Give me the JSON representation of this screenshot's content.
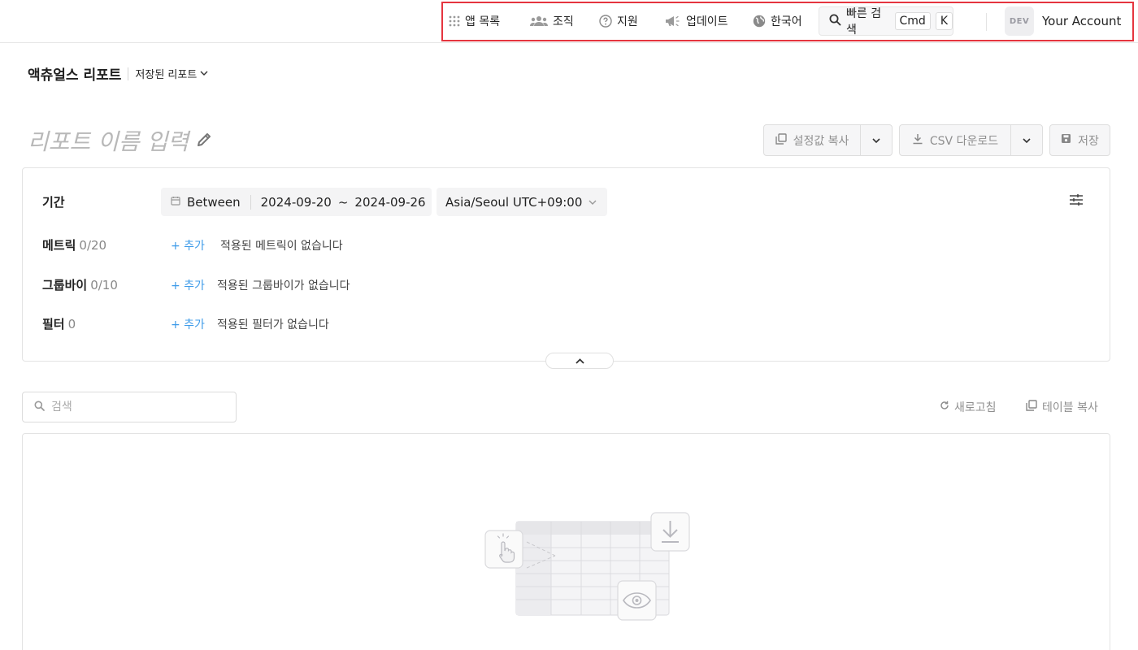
{
  "topnav": {
    "apps_label": "앱 목록",
    "org_label": "조직",
    "support_label": "지원",
    "updates_label": "업데이트",
    "language_label": "한국어",
    "quick_search_label": "빠른 검색",
    "shortcut_cmd": "Cmd",
    "shortcut_key": "K",
    "account_badge": "DEV",
    "account_name": "Your Account",
    "highlight_color": "#e5353f"
  },
  "breadcrumb": {
    "title": "액츄얼스 리포트",
    "saved_reports": "저장된 리포트"
  },
  "report": {
    "name_placeholder": "리포트 이름 입력"
  },
  "actions": {
    "copy_settings": "설정값 복사",
    "csv_download": "CSV 다운로드",
    "save": "저장"
  },
  "config": {
    "period": {
      "label": "기간",
      "mode": "Between",
      "start": "2024-09-20",
      "range_sep": "~",
      "end": "2024-09-26",
      "timezone": "Asia/Seoul UTC+09:00"
    },
    "metrics": {
      "label": "메트릭",
      "count": "0/20",
      "add": "+ 추가",
      "empty": "적용된 메트릭이 없습니다"
    },
    "groupby": {
      "label": "그룹바이",
      "count": "0/10",
      "add": "+ 추가",
      "empty": "적용된 그룹바이가 없습니다"
    },
    "filter": {
      "label": "필터",
      "count": "0",
      "add": "+ 추가",
      "empty": "적용된 필터가 없습니다"
    }
  },
  "table": {
    "search_placeholder": "검색",
    "refresh": "새로고침",
    "copy_table": "테이블 복사"
  },
  "colors": {
    "link": "#3d9be9",
    "muted": "#8f8f8f"
  }
}
